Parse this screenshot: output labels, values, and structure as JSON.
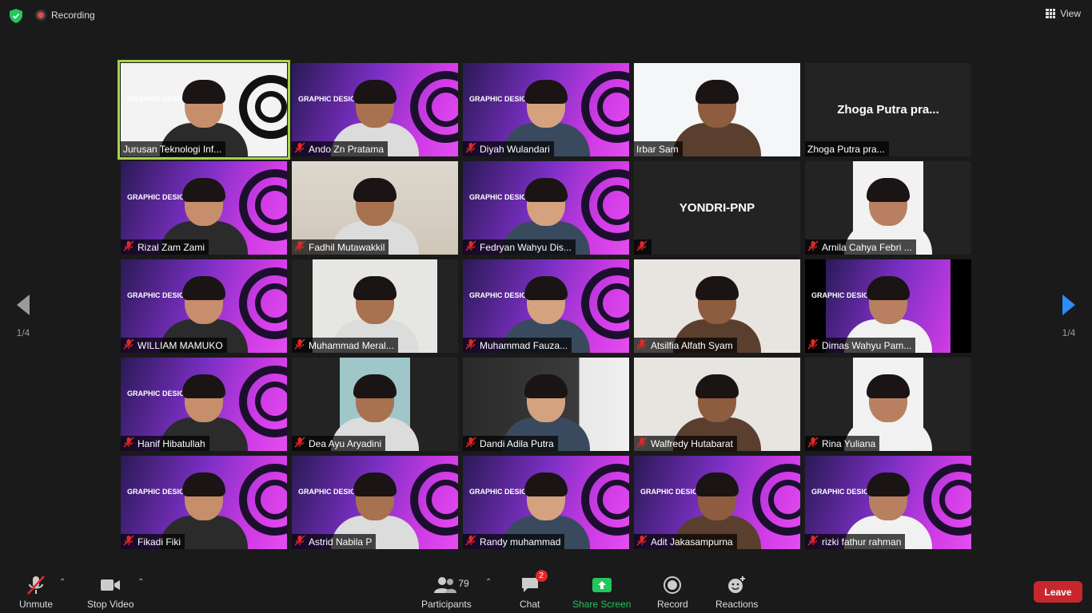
{
  "top_bar": {
    "recording_label": "Recording",
    "view_label": "View"
  },
  "pagination": {
    "left": "1/4",
    "right": "1/4"
  },
  "participants": [
    {
      "name": "Jurusan Teknologi Inf...",
      "muted": false,
      "video": true,
      "active_speaker": true,
      "bg": "poster-white"
    },
    {
      "name": "Ando Zn Pratama",
      "muted": true,
      "video": true,
      "bg": "poster-purple"
    },
    {
      "name": "Diyah Wulandari",
      "muted": true,
      "video": true,
      "bg": "poster-purple"
    },
    {
      "name": "Irbar Sam",
      "muted": false,
      "video": true,
      "bg": "white-icons"
    },
    {
      "name": "Zhoga Putra pra...",
      "muted": false,
      "video": false
    },
    {
      "name": "Rizal Zam Zami",
      "muted": true,
      "video": true,
      "bg": "poster-purple"
    },
    {
      "name": "Fadhil Mutawakkil",
      "muted": true,
      "video": true,
      "bg": "room"
    },
    {
      "name": "Fedryan Wahyu Dis...",
      "muted": true,
      "video": true,
      "bg": "poster-purple"
    },
    {
      "name": "YONDRI-PNP",
      "muted": true,
      "video": false,
      "label_hidden": true
    },
    {
      "name": "Arnila Cahya Febri ...",
      "muted": true,
      "video": true,
      "bg": "white-narrow"
    },
    {
      "name": "WILLIAM MAMUKO",
      "muted": true,
      "video": true,
      "bg": "poster-purple"
    },
    {
      "name": "Muhammad Meral...",
      "muted": true,
      "video": true,
      "bg": "room-narrow"
    },
    {
      "name": "Muhammad Fauza...",
      "muted": true,
      "video": true,
      "bg": "poster-purple"
    },
    {
      "name": "Atsilfia Alfath Syam",
      "muted": true,
      "video": true,
      "bg": "wall-light"
    },
    {
      "name": "Dimas Wahyu Pam...",
      "muted": true,
      "video": true,
      "bg": "poster-narrow"
    },
    {
      "name": "Hanif Hibatullah",
      "muted": true,
      "video": true,
      "bg": "poster-purple"
    },
    {
      "name": "Dea Ayu Aryadini",
      "muted": true,
      "video": true,
      "bg": "wall-narrow"
    },
    {
      "name": "Dandi Adila Putra",
      "muted": true,
      "video": true,
      "bg": "room-dark"
    },
    {
      "name": "Walfredy Hutabarat",
      "muted": true,
      "video": true,
      "bg": "wall-light"
    },
    {
      "name": "Rina Yuliana",
      "muted": true,
      "video": true,
      "bg": "white-narrow"
    },
    {
      "name": "Fikadi Fiki",
      "muted": true,
      "video": true,
      "bg": "poster-purple"
    },
    {
      "name": "Astrid Nabila P",
      "muted": true,
      "video": true,
      "bg": "poster-purple"
    },
    {
      "name": "Randy muhammad",
      "muted": true,
      "video": true,
      "bg": "poster-purple"
    },
    {
      "name": "Adit Jakasampurna",
      "muted": true,
      "video": true,
      "bg": "poster-purple"
    },
    {
      "name": "rizki fathur rahman",
      "muted": true,
      "video": true,
      "bg": "poster-purple"
    }
  ],
  "poster_text": "GRAPHIC DESIGNER",
  "toolbar": {
    "unmute_label": "Unmute",
    "stop_video_label": "Stop Video",
    "participants_label": "Participants",
    "participants_count": "79",
    "chat_label": "Chat",
    "chat_badge": "2",
    "share_screen_label": "Share Screen",
    "record_label": "Record",
    "reactions_label": "Reactions",
    "leave_label": "Leave"
  },
  "colors": {
    "active_speaker_border": "#a7d34a",
    "share_screen_green": "#22c55e",
    "leave_red": "#c8272d",
    "poster_purple": "#b23ee0"
  }
}
